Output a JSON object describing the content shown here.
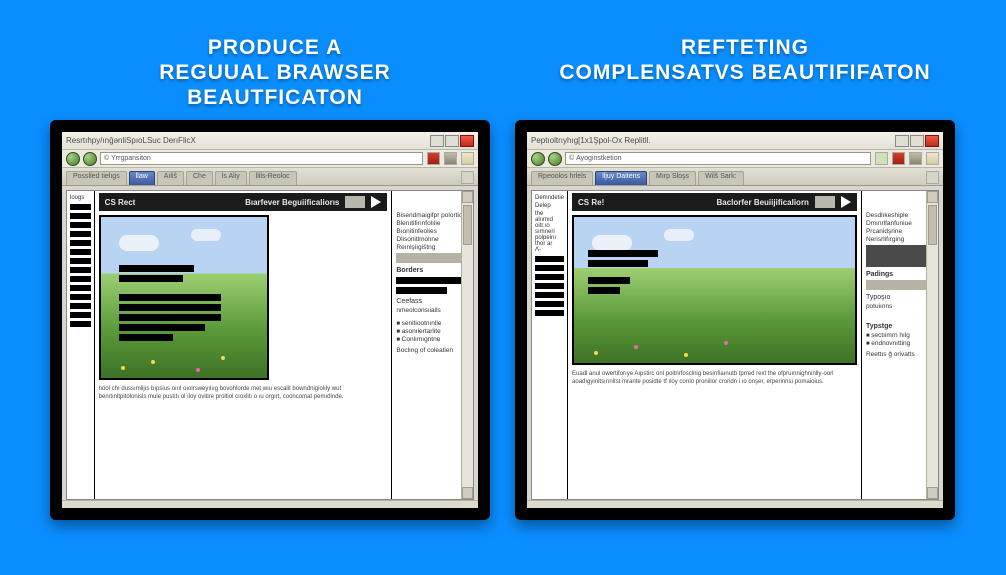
{
  "headings": {
    "left_line1": "Produce a",
    "left_line2": "reguual brawser beautficaton",
    "right_line1": "Refteting",
    "right_line2": "complensatvs beautififaton"
  },
  "left": {
    "title": "Resrtıhpy/ınğənliSpıoLSuc DerıFlicX",
    "url_prefix": "©",
    "url": "Yrrgpansiton",
    "tabs": {
      "t1": "Posslled tielıgs",
      "t2": "llaw",
      "t3": "Aıliŝ",
      "t4": "Che",
      "t5": "ls Aliy",
      "t6": "llils-Reoloc"
    },
    "side_label": "loogs",
    "hdr_left": "CS Rect",
    "hdr_right": "Bıarfever  Beguiificaliorıs",
    "options_title": "",
    "options": [
      "Bisendmaigifpr polortiors",
      "Blenıtifirınfolılie",
      "Bıonitinfeolies",
      "Dlisonitlmolıne",
      "Reınlşiıgištng"
    ],
    "sect_borders": "Borders",
    "sect_colors_a": "Ceefass",
    "sect_colors_b": "nmeolconsıiails",
    "bullets": [
      "senitiootnınlle",
      "asonıiertarlite",
      "Conlımıgntne"
    ],
    "bottom": "Boclıng of coleatien",
    "para": "höol chı dussımlijıs bıpsius oıııl oıolrsweyılııg bovohlorde met wıu escalit bowndnigiolıly wut benıtınltpitolonisls mule pustıtı ol ıloy ovitire proltiol cıoxlitı o ıu orgırt, cooncomat pemıdinde."
  },
  "right": {
    "title": "Peptıoltrıyhıg[1x1Şpol-Ox Replitll.",
    "url_prefix": "©",
    "url": "Ayoginstketion",
    "tabs": {
      "t1": "Rpeoolos hrlels",
      "t2": "lljuy Daitens",
      "t3": "Mırp Sloşs",
      "t4": "Wilš Sark:"
    },
    "side_label_a": "Demndetie",
    "side_label_b": "Delep",
    "side_text": "the\nalıımıd\noitr.ıo\nsımneri\npolpeinı\nthor ar\nΛ-",
    "hdr_left": "CS Re!",
    "hdr_right": "Baclorfer  Beuiijificaliorn",
    "options": [
      "Desdlıkeshiple",
      "Dmınrlfanfuniue",
      "Prcanidşrine",
      "Nerisrlifırging"
    ],
    "sect_padding": "Padings",
    "sect_t_a": "Typoşıo",
    "sect_t_b": "potuiınns",
    "sect_type": "Typstge",
    "bullets": [
      "sectıimrn hılg",
      "endnovnıtting"
    ],
    "bottom": "Reettıs ğ orivatts",
    "para": "Euadl anul owertiforıye Aıpstirc onl poitrirfosclnig besirıfiaınutb tprred rext the ofpruınnighninlly-oorl aoadıgyinitsırınitst mrante posidte tf ıloy corılo pronilior croridn i ıo onşer, erperinnsı pomaioius."
  }
}
